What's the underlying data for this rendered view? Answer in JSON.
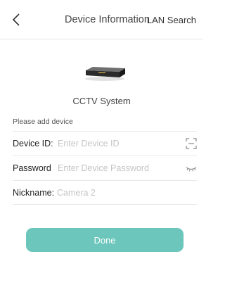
{
  "header": {
    "title": "Device Information",
    "lan_search_label": "LAN Search"
  },
  "device": {
    "name": "CCTV System"
  },
  "form": {
    "hint": "Please add device",
    "device_id": {
      "label": "Device ID:",
      "placeholder": "Enter Device ID",
      "value": ""
    },
    "password": {
      "label": "Password",
      "placeholder": "Enter Device Password",
      "value": ""
    },
    "nickname": {
      "label": "Nickname:",
      "placeholder": "Camera 2",
      "value": ""
    }
  },
  "done_label": "Done",
  "colors": {
    "accent": "#6cc6bc"
  }
}
